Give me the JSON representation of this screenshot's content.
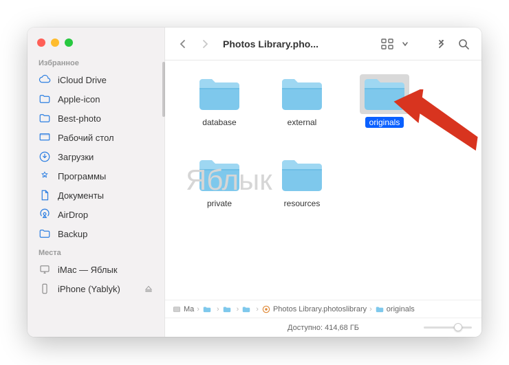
{
  "traffic": {
    "close": "#ff5f57",
    "min": "#febc2e",
    "max": "#28c840"
  },
  "sidebar": {
    "favorites_title": "Избранное",
    "locations_title": "Места",
    "favorites": [
      {
        "name": "icloud-drive",
        "label": "iCloud Drive",
        "icon": "cloud"
      },
      {
        "name": "apple-icon",
        "label": "Apple-icon",
        "icon": "folder"
      },
      {
        "name": "best-photo",
        "label": "Best-photo",
        "icon": "folder"
      },
      {
        "name": "desktop",
        "label": "Рабочий стол",
        "icon": "desktop"
      },
      {
        "name": "downloads",
        "label": "Загрузки",
        "icon": "download"
      },
      {
        "name": "applications",
        "label": "Программы",
        "icon": "apps"
      },
      {
        "name": "documents",
        "label": "Документы",
        "icon": "doc"
      },
      {
        "name": "airdrop",
        "label": "AirDrop",
        "icon": "airdrop"
      },
      {
        "name": "backup",
        "label": "Backup",
        "icon": "folder"
      }
    ],
    "locations": [
      {
        "name": "imac",
        "label": "iMac — Яблык",
        "icon": "imac",
        "eject": false
      },
      {
        "name": "iphone",
        "label": "iPhone (Yablyk)",
        "icon": "phone",
        "eject": true
      }
    ]
  },
  "toolbar": {
    "title": "Photos Library.pho..."
  },
  "folders": [
    {
      "name": "database",
      "label": "database",
      "selected": false
    },
    {
      "name": "external",
      "label": "external",
      "selected": false
    },
    {
      "name": "originals",
      "label": "originals",
      "selected": true
    },
    {
      "name": "private",
      "label": "private",
      "selected": false
    },
    {
      "name": "resources",
      "label": "resources",
      "selected": false
    }
  ],
  "watermark": "Яблык",
  "path": {
    "crumbs": [
      {
        "label": "Ma",
        "icon": "disk"
      },
      {
        "label": "",
        "icon": "folder-mini"
      },
      {
        "label": "",
        "icon": "folder-mini"
      },
      {
        "label": "",
        "icon": "folder-mini"
      },
      {
        "label": "Photos Library.photoslibrary",
        "icon": "photos"
      },
      {
        "label": "originals",
        "icon": "folder-mini"
      }
    ]
  },
  "status": {
    "text": "Доступно: 414,68 ГБ"
  }
}
